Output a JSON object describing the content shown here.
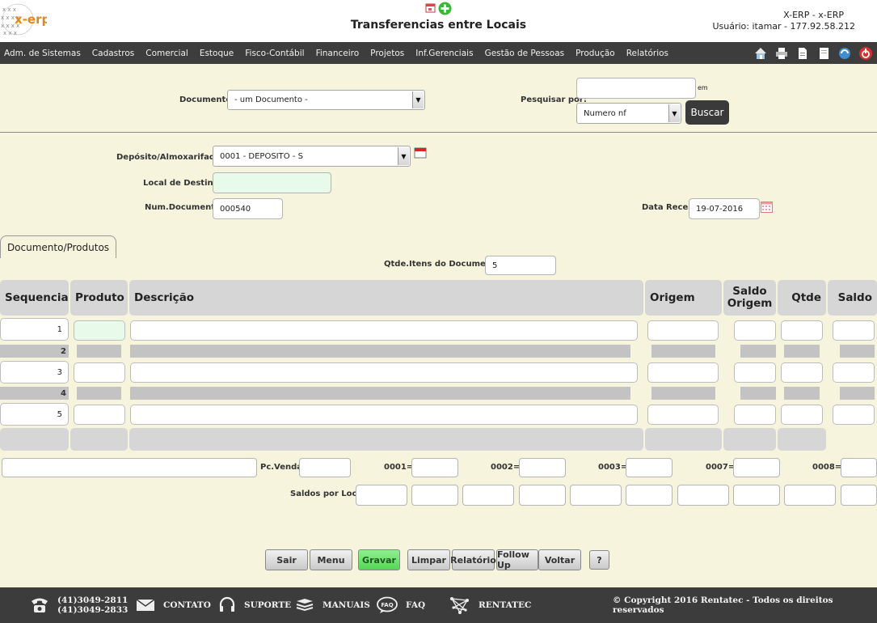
{
  "header": {
    "title": "Transferencias entre Locais",
    "system": "X-ERP - x-ERP",
    "user": "Usuário: itamar - 177.92.58.212",
    "logo_text": "x-erp"
  },
  "menu": [
    "Adm. de Sistemas",
    "Cadastros",
    "Comercial",
    "Estoque",
    "Fisco-Contábil",
    "Financeiro",
    "Projetos",
    "Inf.Gerenciais",
    "Gestão de Pessoas",
    "Produção",
    "Relatórios"
  ],
  "search": {
    "documento_label": "Documento",
    "documento_value": "- um Documento -",
    "pesquisar_label": "Pesquisar por:",
    "pesquisar_value": "",
    "em_label": "em",
    "campo_value": "Numero nf",
    "buscar_label": "Buscar"
  },
  "form": {
    "deposito_label": "Depósito/Almoxarifado",
    "deposito_value": "0001 - DEPOSITO - S",
    "destino_label": "Local de Destino",
    "destino_value": "",
    "numdoc_label": "Num.Documento",
    "numdoc_value": "000540",
    "data_label": "Data Receb.",
    "data_value": "19-07-2016",
    "required_mark": "*"
  },
  "tab": {
    "label": "Documento/Produtos"
  },
  "qtde": {
    "label": "Qtde.Itens do Documento",
    "value": "5"
  },
  "table": {
    "headers": [
      "Sequencia",
      "Produto",
      "Descrição",
      "Origem",
      "Saldo Origem",
      "Qtde",
      "Saldo"
    ],
    "rows": [
      "1",
      "2",
      "3",
      "4",
      "5"
    ]
  },
  "bottom": {
    "pcvenda_label": "Pc.Venda",
    "loc1": "0001=",
    "loc2": "0002=",
    "loc3": "0003=",
    "loc4": "0007=",
    "loc5": "0008=",
    "saldos_label": "Saldos por Local"
  },
  "buttons": {
    "sair": "Sair",
    "menu": "Menu",
    "gravar": "Gravar",
    "limpar": "Limpar",
    "relatorio": "Relatório",
    "followup": "Follow Up",
    "voltar": "Voltar",
    "help": "?"
  },
  "footer": {
    "phone1": "(41)3049-2811",
    "phone2": "(41)3049-2833",
    "contato": "CONTATO",
    "suporte": "SUPORTE",
    "manuais": "MANUAIS",
    "faq": "FAQ",
    "faq_badge": "FAQ",
    "rentatec": "RENTATEC",
    "copyright": "© Copyright 2016 Rentatec - Todos os direitos reservados"
  },
  "colors": {
    "background": "#f7f4dd",
    "menubar": "#3d3d3d",
    "gravar": "#66e066",
    "footer": "#3c3c3c"
  }
}
